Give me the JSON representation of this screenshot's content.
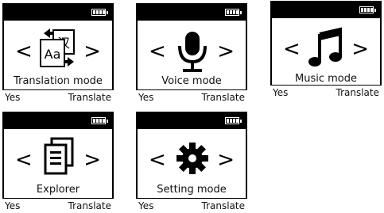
{
  "screens": [
    {
      "label": "Translation mode",
      "icon": "translation-icon",
      "left_key": "Yes",
      "right_key": "Translate",
      "lang_a": "Aa",
      "lang_b": "汉"
    },
    {
      "label": "Voice mode",
      "icon": "microphone-icon",
      "left_key": "Yes",
      "right_key": "Translate"
    },
    {
      "label": "Music mode",
      "icon": "music-note-icon",
      "left_key": "Yes",
      "right_key": "Translate"
    },
    {
      "label": "Explorer",
      "icon": "document-icon",
      "left_key": "Yes",
      "right_key": "Translate"
    },
    {
      "label": "Setting mode",
      "icon": "gear-icon",
      "left_key": "Yes",
      "right_key": "Translate"
    }
  ],
  "arrows": {
    "left": "<",
    "right": ">"
  }
}
